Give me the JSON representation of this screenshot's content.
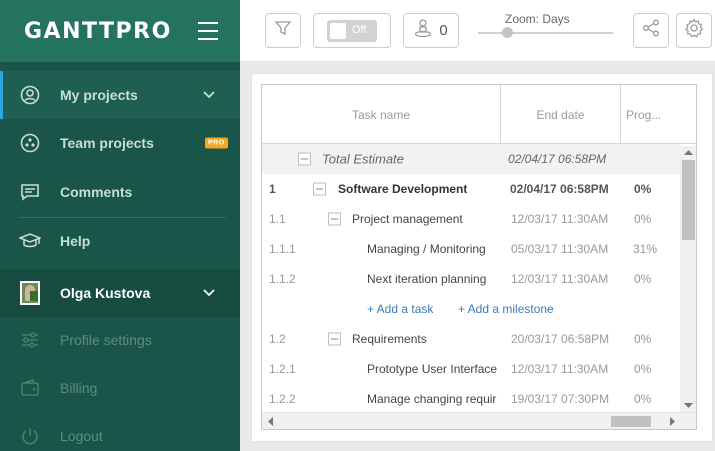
{
  "app": {
    "logo": "GANTTPRO"
  },
  "sidebar": {
    "items": [
      {
        "label": "My projects"
      },
      {
        "label": "Team projects",
        "badge": "PRO"
      },
      {
        "label": "Comments"
      },
      {
        "label": "Help"
      },
      {
        "label": "Olga Kustova"
      },
      {
        "label": "Profile settings"
      },
      {
        "label": "Billing"
      },
      {
        "label": "Logout"
      }
    ]
  },
  "toolbar": {
    "toggle_label": "Off",
    "people_count": "0",
    "zoom_label": "Zoom: Days"
  },
  "grid": {
    "columns": [
      "Task name",
      "End date",
      "Prog..."
    ],
    "total": {
      "name": "Total Estimate",
      "end": "02/04/17 06:58PM"
    },
    "rows": [
      {
        "wbs": "1",
        "name": "Software Development",
        "end": "02/04/17 06:58PM",
        "progress": "0%"
      },
      {
        "wbs": "1.1",
        "name": "Project management",
        "end": "12/03/17 11:30AM",
        "progress": "0%"
      },
      {
        "wbs": "1.1.1",
        "name": "Managing / Monitoring",
        "end": "05/03/17 11:30AM",
        "progress": "31%"
      },
      {
        "wbs": "1.1.2",
        "name": "Next iteration planning",
        "end": "12/03/17 11:30AM",
        "progress": "0%"
      },
      {
        "wbs": "1.2",
        "name": "Requirements",
        "end": "20/03/17 06:58PM",
        "progress": "0%"
      },
      {
        "wbs": "1.2.1",
        "name": "Prototype User Interface",
        "end": "12/03/17 11:30AM",
        "progress": "0%"
      },
      {
        "wbs": "1.2.2",
        "name": "Manage changing requir",
        "end": "19/03/17 07:30PM",
        "progress": "0%"
      }
    ],
    "add_task": "+ Add a task",
    "add_milestone": "+ Add a milestone"
  },
  "colors": {
    "sidebar": "#195548",
    "header": "#24735f",
    "accent": "#2aa8e0",
    "link": "#3a7bbf",
    "badge": "#f5a623"
  }
}
